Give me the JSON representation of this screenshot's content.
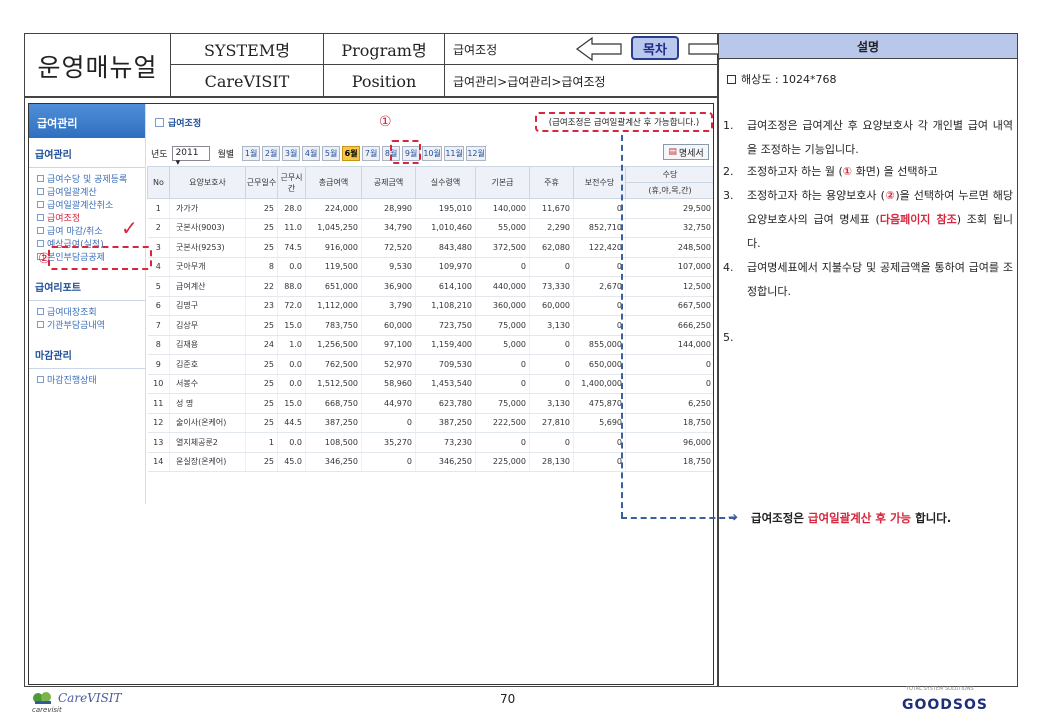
{
  "header": {
    "title": "운영매뉴얼",
    "system_label": "SYSTEM명",
    "program_label": "Program명",
    "program_value": "급여조정",
    "carevisit_label": "CareVISIT",
    "position_label": "Position",
    "position_value": "급여관리>급여관리>급여조정",
    "toc_label": "목차"
  },
  "screen": {
    "sidebar": {
      "top": "급여관리",
      "sections": [
        {
          "title": "급여관리",
          "items": [
            "급여수당 및 공제등록",
            "급여일괄계산",
            "급여일괄계산취소",
            "급여조정",
            "급여 마감/취소",
            "예상급여(실적)",
            "본인부담금공제"
          ]
        },
        {
          "title": "급여리포트",
          "items": [
            "급여대장조회",
            "기관부담금내역"
          ]
        },
        {
          "title": "마감관리",
          "items": [
            "마감진행상태"
          ]
        }
      ],
      "active_item": "급여조정"
    },
    "breadcrumb": "급여조정",
    "notice": "(급여조정은 급여일괄계산 후 가능합니다.)",
    "marker_1": "①",
    "marker_2": "②",
    "year_label": "년도",
    "year_value": "2011 ▾",
    "month_label": "월별",
    "months": [
      "1월",
      "2월",
      "3월",
      "4월",
      "5월",
      "6월",
      "7월",
      "8월",
      "9월",
      "10월",
      "11월",
      "12월"
    ],
    "selected_month": "6월",
    "pay_button": "명세서",
    "columns": [
      "No",
      "요양보호사",
      "근무일수",
      "근무시간",
      "총급여액",
      "공제금액",
      "실수령액",
      "기본급",
      "주휴",
      "보전수당",
      "수당"
    ],
    "col_sub": "(휴,야,목,간)",
    "rows": [
      [
        "1",
        "가가가",
        "25",
        "28.0",
        "224,000",
        "28,990",
        "195,010",
        "140,000",
        "11,670",
        "0",
        "29,500"
      ],
      [
        "2",
        "굿본사(9003)",
        "25",
        "11.0",
        "1,045,250",
        "34,790",
        "1,010,460",
        "55,000",
        "2,290",
        "852,710",
        "32,750"
      ],
      [
        "3",
        "굿본사(9253)",
        "25",
        "74.5",
        "916,000",
        "72,520",
        "843,480",
        "372,500",
        "62,080",
        "122,420",
        "248,500"
      ],
      [
        "4",
        "굿아무개",
        "8",
        "0.0",
        "119,500",
        "9,530",
        "109,970",
        "0",
        "0",
        "0",
        "107,000"
      ],
      [
        "5",
        "급여계산",
        "22",
        "88.0",
        "651,000",
        "36,900",
        "614,100",
        "440,000",
        "73,330",
        "2,670",
        "12,500"
      ],
      [
        "6",
        "김명구",
        "23",
        "72.0",
        "1,112,000",
        "3,790",
        "1,108,210",
        "360,000",
        "60,000",
        "0",
        "667,500"
      ],
      [
        "7",
        "김상무",
        "25",
        "15.0",
        "783,750",
        "60,000",
        "723,750",
        "75,000",
        "3,130",
        "0",
        "666,250"
      ],
      [
        "8",
        "김재용",
        "24",
        "1.0",
        "1,256,500",
        "97,100",
        "1,159,400",
        "5,000",
        "0",
        "855,000",
        "144,000"
      ],
      [
        "9",
        "김준호",
        "25",
        "0.0",
        "762,500",
        "52,970",
        "709,530",
        "0",
        "0",
        "650,000",
        "0"
      ],
      [
        "10",
        "서봉수",
        "25",
        "0.0",
        "1,512,500",
        "58,960",
        "1,453,540",
        "0",
        "0",
        "1,400,000",
        "0"
      ],
      [
        "11",
        "성 명",
        "25",
        "15.0",
        "668,750",
        "44,970",
        "623,780",
        "75,000",
        "3,130",
        "475,870",
        "6,250"
      ],
      [
        "12",
        "술이사(온케어)",
        "25",
        "44.5",
        "387,250",
        "0",
        "387,250",
        "222,500",
        "27,810",
        "5,690",
        "18,750"
      ],
      [
        "13",
        "열지체공룬2",
        "1",
        "0.0",
        "108,500",
        "35,270",
        "73,230",
        "0",
        "0",
        "0",
        "96,000"
      ],
      [
        "14",
        "윤실장(온케어)",
        "25",
        "45.0",
        "346,250",
        "0",
        "346,250",
        "225,000",
        "28,130",
        "0",
        "18,750"
      ]
    ]
  },
  "description": {
    "title": "설명",
    "resolution": "해상도 : 1024*768",
    "items": [
      {
        "n": "1.",
        "text": "급여조정은 급여계산 후 요양보호사 각 개인별 급여 내역을 조정하는 기능입니다."
      },
      {
        "n": "2.",
        "text_a": "조정하고자 하는 월 (",
        "mark": "①",
        "text_b": " 화면) 을 선택하고"
      },
      {
        "n": "3.",
        "text_a": "조정하고자 하는 용양보호사 (",
        "mark": "②",
        "text_b": ")을 선택하여 누르면 해당 요양보호사의 급여 명세표 (",
        "red": "다음페이지 참조",
        "text_c": ") 조회 됩니다."
      },
      {
        "n": "4.",
        "text": "급여명세표에서 지불수당 및 공제금액을 통하여 급여를 조정합니다."
      },
      {
        "n": "5.",
        "text": ""
      }
    ],
    "note_a": "급여조정은 ",
    "note_red": "급여일괄계산 후  가능",
    "note_b": " 합니다."
  },
  "footer": {
    "brand": "CareVISIT",
    "brand_sub": "carevisit",
    "page": "70",
    "good_logo": "GOODSOS",
    "good_tag": "TOTAL SYSTEM SOLUTIONS"
  },
  "colors": {
    "accent_red": "#d7263d",
    "header_blue": "#b8c7ea",
    "sidebar_blue": "#2f6fbf",
    "month_selected": "#f5c84a"
  }
}
